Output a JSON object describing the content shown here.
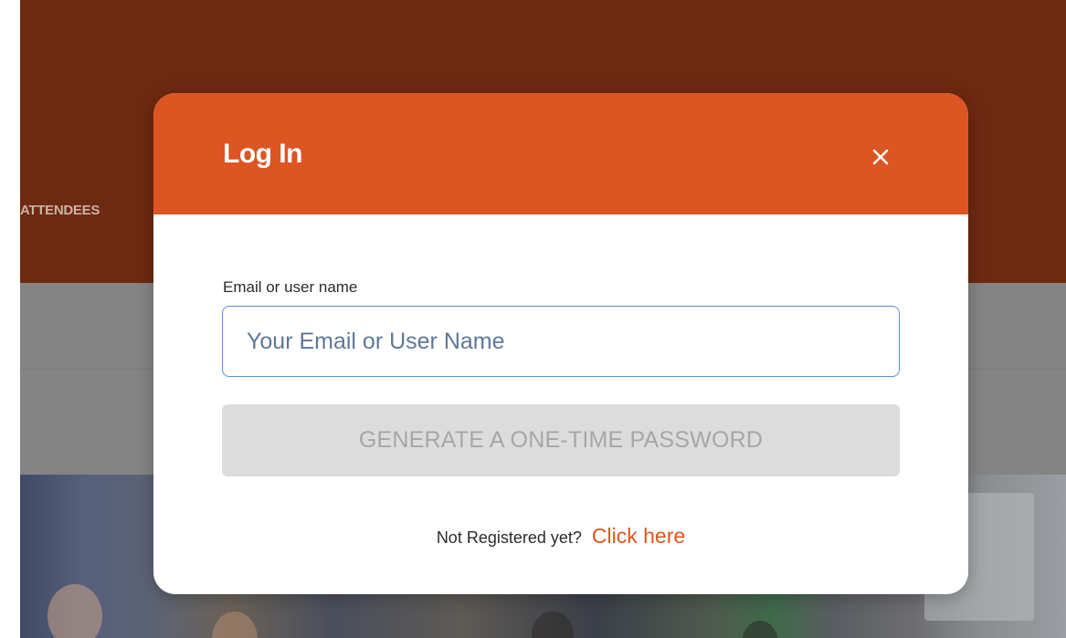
{
  "background": {
    "nav_item": "ATTENDEES",
    "header_color": "#6e2911"
  },
  "modal": {
    "title": "Log In",
    "close_icon": "close-icon",
    "accent_color": "#dc5523",
    "email_field": {
      "label": "Email or user name",
      "value": "",
      "placeholder": "Your Email or User Name"
    },
    "otp_button_label": "GENERATE A ONE-TIME PASSWORD",
    "register_prompt": "Not Registered yet?",
    "register_link_label": "Click here"
  }
}
